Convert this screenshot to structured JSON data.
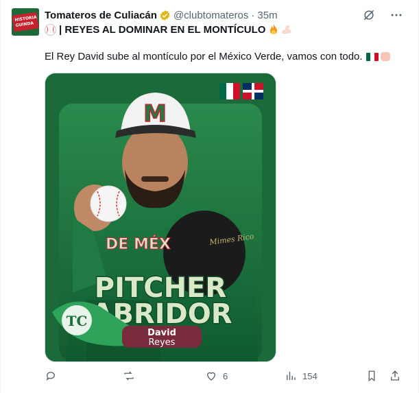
{
  "author": {
    "display_name": "Tomateros de Culiacán",
    "handle": "@clubtomateros",
    "separator": "·",
    "time": "35m",
    "avatar_text": [
      "HISTORIA",
      "GUINDA"
    ]
  },
  "post": {
    "headline": "| REYES AL DOMINAR EN EL MONTÍCULO",
    "body": "El Rey David sube al montículo por el México Verde, vamos con todo."
  },
  "media": {
    "title_line1": "PITCHER",
    "title_line2": "ABRIDOR",
    "first_name": "David",
    "last_name": "Reyes",
    "cap_letter": "M",
    "jersey_text": "DE MÉX",
    "glove_signature": "Mimes Rico",
    "team_logo_letters": "TC"
  },
  "actions": {
    "reply_count": "",
    "repost_count": "",
    "like_count": "6",
    "views_count": "154"
  },
  "colors": {
    "accent_green": "#1b6e3c",
    "name_plate": "#7a2a3d",
    "title_fill": "#d9e8c6"
  }
}
